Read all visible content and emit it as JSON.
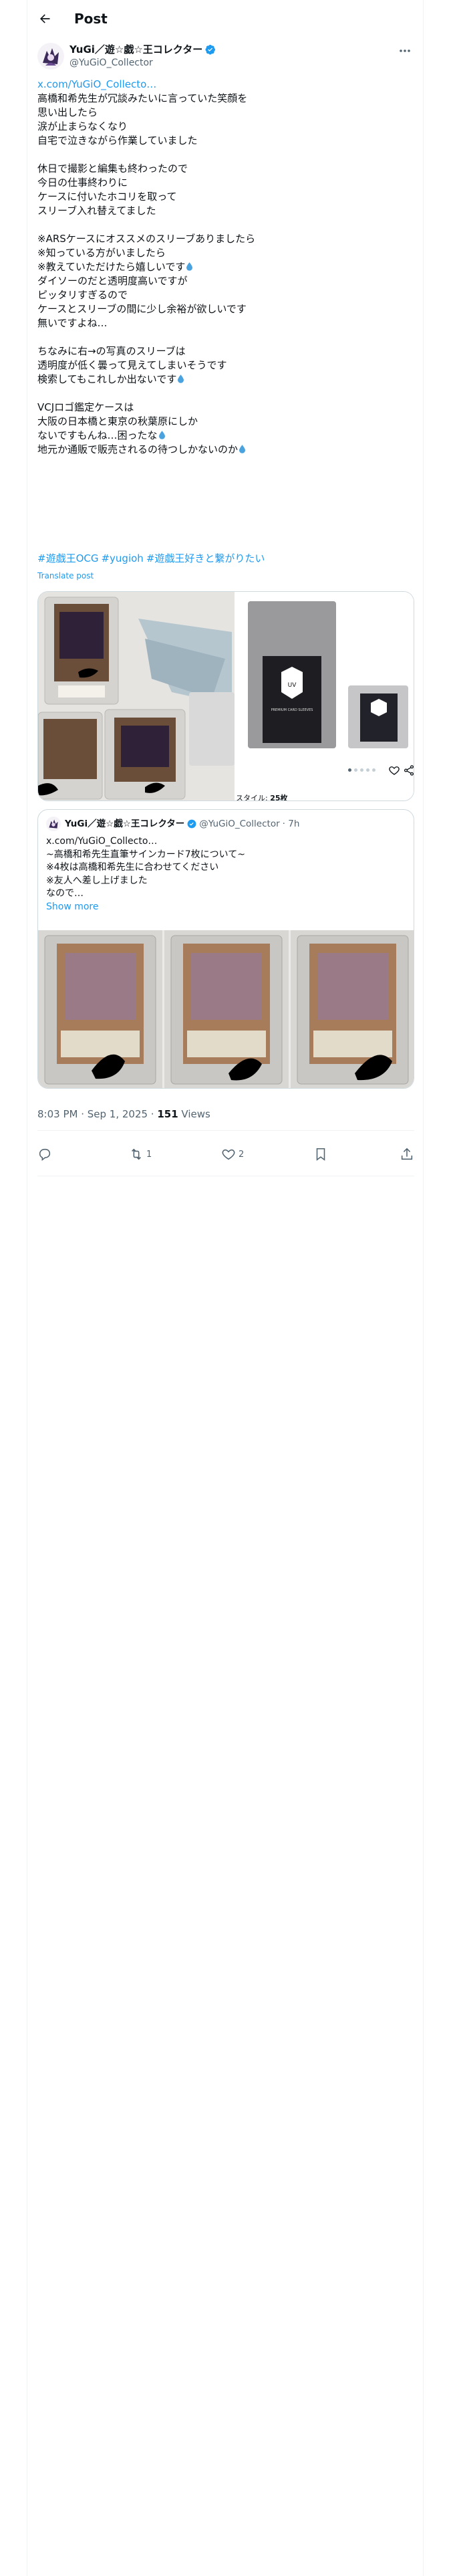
{
  "header": {
    "title": "Post"
  },
  "author": {
    "name": "YuGi／遊☆戯☆王コレクター",
    "handle": "@YuGiO_Collector"
  },
  "tweet": {
    "link": "x.com/YuGiO_Collecto…",
    "lines_a": "高橋和希先生が冗談みたいに言っていた笑顔を\n思い出したら\n涙が止まらなくなり\n自宅で泣きながら作業していました\n\n休日で撮影と編集も終わったので\n今日の仕事終わりに\nケースに付いたホコリを取って\nスリーブ入れ替えてました\n\n※ARSケースにオススメのスリーブありましたら\n※知っている方がいましたら\n※教えていただけたら嬉しいです",
    "lines_b": "ダイソーのだと透明度高いですが\nピッタリすぎるので\nケースとスリーブの間に少し余裕が欲しいです\n無いですよね…\n\nちなみに右→の写真のスリーブは\n透明度が低く曇って見えてしまいそうです\n検索してもこれしか出ないです",
    "lines_c": "VCJロゴ鑑定ケースは\n大阪の日本橋と東京の秋葉原にしか\nないですもんね…困ったな",
    "lines_d": "地元か通販で販売されるの待つしかないのか",
    "hashtags": [
      "#遊戯王OCG",
      "#yugioh",
      "#遊戯王好きと繋がりたい"
    ],
    "translate": "Translate post"
  },
  "media": {
    "caption_prefix": "スタイル:",
    "caption_count": "25枚",
    "pack_label_1": "UV",
    "pack_label_2": "PREMIUM CARD SLEEVES"
  },
  "quote": {
    "name": "YuGi／遊☆戯☆王コレクター",
    "handle": "@YuGiO_Collector",
    "time": "· 7h",
    "text": "x.com/YuGiO_Collecto…\n~高橋和希先生直筆サインカード7枚について~\n※4枚は高橋和希先生に合わせてください\n※友人へ差し上げました\nなので…",
    "show_more": "Show more"
  },
  "meta": {
    "timestamp": "8:03 PM · Sep 1, 2025 · ",
    "views_count": "151",
    "views_label": " Views"
  },
  "actions": {
    "reposts": "1",
    "likes": "2"
  },
  "colors": {
    "accent": "#1d9bf0",
    "text": "#0f1419",
    "muted": "#536471",
    "border": "#cfd9de"
  }
}
